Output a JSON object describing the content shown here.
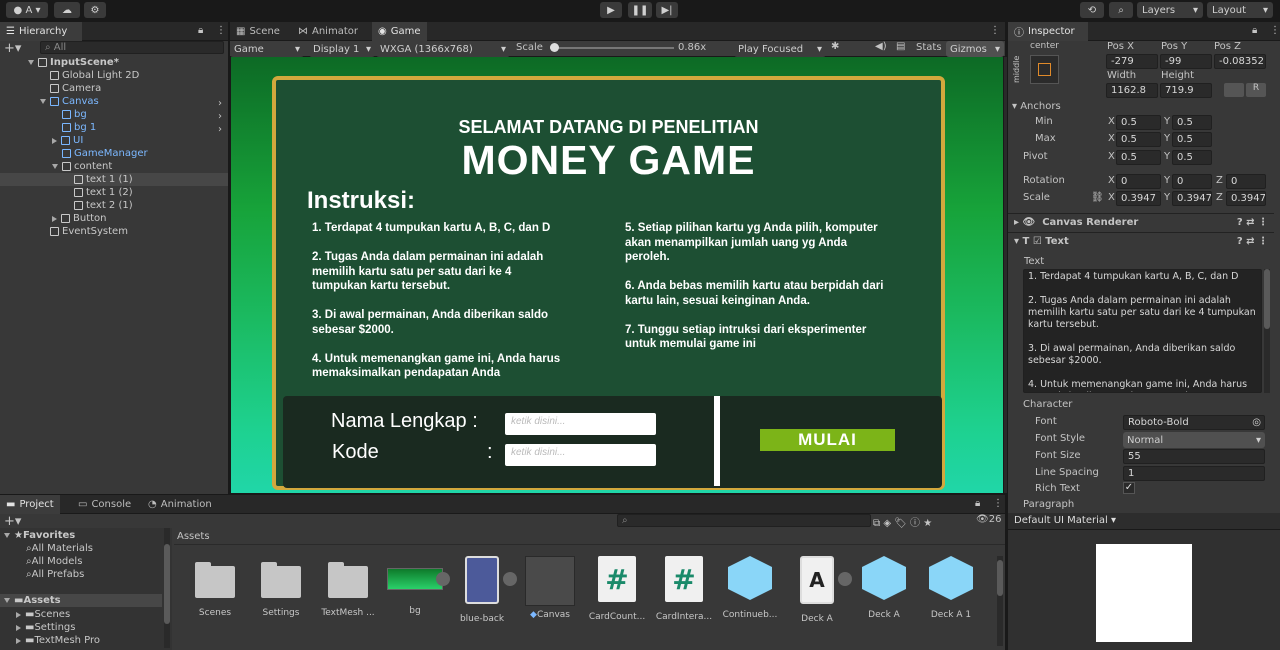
{
  "toolbar": {
    "account": "A",
    "layers": "Layers",
    "layout": "Layout"
  },
  "hierarchy": {
    "tab": "Hierarchy",
    "search_placeholder": "All",
    "items": [
      {
        "label": "InputScene*"
      },
      {
        "label": "Global Light 2D"
      },
      {
        "label": "Camera"
      },
      {
        "label": "Canvas"
      },
      {
        "label": "bg"
      },
      {
        "label": "bg 1"
      },
      {
        "label": "UI"
      },
      {
        "label": "GameManager"
      },
      {
        "label": "content"
      },
      {
        "label": "text 1 (1)"
      },
      {
        "label": "text 1 (2)"
      },
      {
        "label": "text 2 (1)"
      },
      {
        "label": "Button"
      },
      {
        "label": "EventSystem"
      }
    ]
  },
  "tabs": {
    "scene": "Scene",
    "animator": "Animator",
    "game": "Game"
  },
  "gamebar": {
    "mode": "Game",
    "display": "Display 1",
    "resolution": "WXGA (1366x768)",
    "scale_label": "Scale",
    "scale_value": "0.86x",
    "play_focused": "Play Focused",
    "stats": "Stats",
    "gizmos": "Gizmos"
  },
  "game": {
    "welcome": "SELAMAT DATANG DI PENELITIAN",
    "title": "MONEY GAME",
    "instr_heading": "Instruksi:",
    "left_text": "1. Terdapat 4 tumpukan kartu A, B, C, dan D\n\n2. Tugas Anda dalam permainan ini adalah\nmemilih kartu satu per satu dari ke 4\ntumpukan kartu tersebut.\n\n3. Di awal permainan, Anda diberikan saldo\nsebesar $2000.\n\n4. Untuk memenangkan game ini, Anda harus\nmemaksimalkan pendapatan Anda",
    "right_text": "5. Setiap pilihan kartu yg Anda pilih, komputer\nakan menampilkan jumlah uang yg Anda\nperoleh.\n\n6. Anda bebas memilih kartu atau berpidah dari\nkartu lain, sesuai keinginan Anda.\n\n7. Tunggu setiap intruksi dari eksperimenter\nuntuk memulai game ini",
    "name_label": "Nama Lengkap :",
    "code_label": "Kode",
    "code_colon": ":",
    "name_placeholder": "ketik disini...",
    "code_placeholder": "ketik disini...",
    "start_button": "MULAI"
  },
  "inspector": {
    "tab": "Inspector",
    "anchor_label": "center",
    "anchor_side": "middle",
    "posx_l": "Pos X",
    "posy_l": "Pos Y",
    "posz_l": "Pos Z",
    "posx": "-279",
    "posy": "-99",
    "posz": "-0.08352",
    "width_l": "Width",
    "height_l": "Height",
    "width": "1162.8",
    "height": "719.9",
    "anchors": "Anchors",
    "min": "Min",
    "max": "Max",
    "pivot": "Pivot",
    "min_x": "0.5",
    "min_y": "0.5",
    "max_x": "0.5",
    "max_y": "0.5",
    "pivot_x": "0.5",
    "pivot_y": "0.5",
    "rotation": "Rotation",
    "scale": "Scale",
    "rot_x": "0",
    "rot_y": "0",
    "rot_z": "0",
    "scale_x": "0.3947",
    "scale_y": "0.3947",
    "scale_z": "0.3947",
    "canvas_renderer": "Canvas Renderer",
    "text_component": "Text",
    "text_label": "Text",
    "text_value": "1. Terdapat 4 tumpukan kartu A, B, C, dan D\n\n2. Tugas Anda dalam permainan ini adalah memilih kartu satu per satu dari ke 4 tumpukan kartu tersebut.\n\n3. Di awal permainan, Anda diberikan saldo sebesar $2000.\n\n4. Untuk memenangkan game ini, Anda harus memaksimalkan pendapatan Anda",
    "character": "Character",
    "font_l": "Font",
    "font": "Roboto-Bold",
    "font_style_l": "Font Style",
    "font_style": "Normal",
    "font_size_l": "Font Size",
    "font_size": "55",
    "line_spacing_l": "Line Spacing",
    "line_spacing": "1",
    "rich_text_l": "Rich Text",
    "paragraph": "Paragraph",
    "material": "Default UI Material",
    "axis_x": "X",
    "axis_y": "Y",
    "axis_z": "Z"
  },
  "project": {
    "tabs": [
      "Project",
      "Console",
      "Animation"
    ],
    "count": "26",
    "favorites": "Favorites",
    "fav_items": [
      "All Materials",
      "All Models",
      "All Prefabs"
    ],
    "assets": "Assets",
    "asset_folders": [
      "Scenes",
      "Settings",
      "TextMesh Pro"
    ],
    "breadcrumb": "Assets",
    "assets_list": [
      "Scenes",
      "Settings",
      "TextMesh ...",
      "bg",
      "blue-back",
      "Canvas",
      "CardCount...",
      "CardIntera...",
      "Continueb...",
      "Deck A",
      "Deck A",
      "Deck A 1"
    ],
    "deck_letter": "A",
    "hash": "#"
  }
}
